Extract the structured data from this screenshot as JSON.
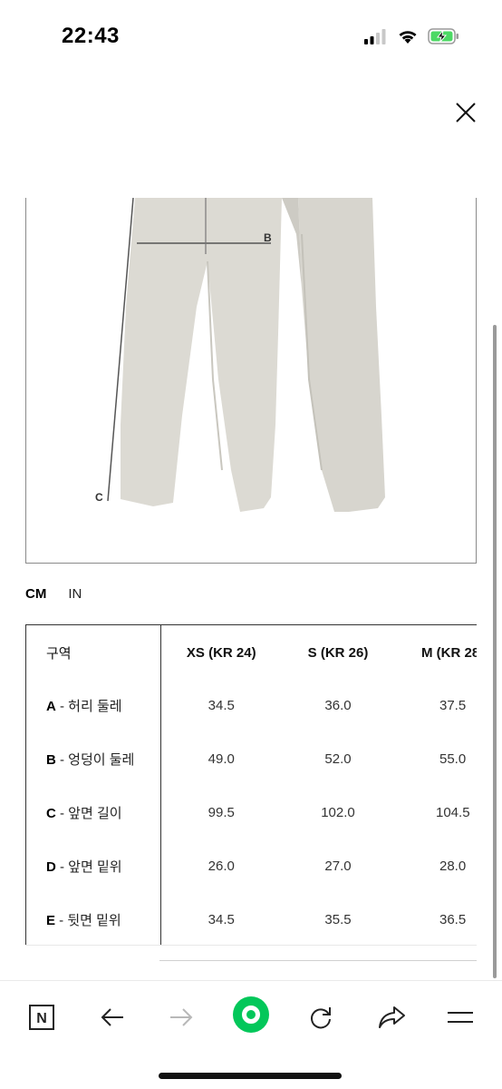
{
  "status_bar": {
    "time": "22:43",
    "icons": [
      "signal-icon",
      "wifi-icon",
      "battery-charging-icon"
    ],
    "battery_color": "#4cd964"
  },
  "modal": {
    "close_icon": "close-icon"
  },
  "product_image": {
    "labels": {
      "b": "B",
      "c": "C"
    },
    "garment_color": "#dcdad3"
  },
  "units": {
    "cm": "CM",
    "in": "IN",
    "selected": "CM"
  },
  "size_table": {
    "zone_header": "구역",
    "sizes": [
      "XS (KR 24)",
      "S (KR 26)",
      "M (KR 28"
    ],
    "rows": [
      {
        "code": "A",
        "label": " - 허리 둘레",
        "values": [
          "34.5",
          "36.0",
          "37.5"
        ]
      },
      {
        "code": "B",
        "label": " - 엉덩이 둘레",
        "values": [
          "49.0",
          "52.0",
          "55.0"
        ]
      },
      {
        "code": "C",
        "label": " - 앞면 길이",
        "values": [
          "99.5",
          "102.0",
          "104.5"
        ]
      },
      {
        "code": "D",
        "label": " - 앞면 밑위",
        "values": [
          "26.0",
          "27.0",
          "28.0"
        ]
      },
      {
        "code": "E",
        "label": " - 뒷면 밑위",
        "values": [
          "34.5",
          "35.5",
          "36.5"
        ]
      }
    ]
  },
  "toolbar": {
    "home_label": "N",
    "items": [
      "naver-home-icon",
      "back-arrow-icon",
      "forward-arrow-icon",
      "green-dot-icon",
      "reload-icon",
      "share-icon",
      "menu-icon"
    ],
    "accent_color": "#03c75a"
  }
}
